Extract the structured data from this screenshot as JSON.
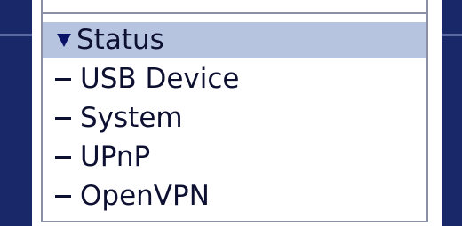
{
  "menu": {
    "section_label": "Status",
    "items": [
      {
        "label": "USB Device"
      },
      {
        "label": "System"
      },
      {
        "label": "UPnP"
      },
      {
        "label": "OpenVPN"
      }
    ]
  },
  "colors": {
    "rail": "#182868",
    "highlight": "#b6c4e0",
    "border": "#8a8fa6",
    "text": "#0d1030",
    "triangle": "#0a1466"
  }
}
